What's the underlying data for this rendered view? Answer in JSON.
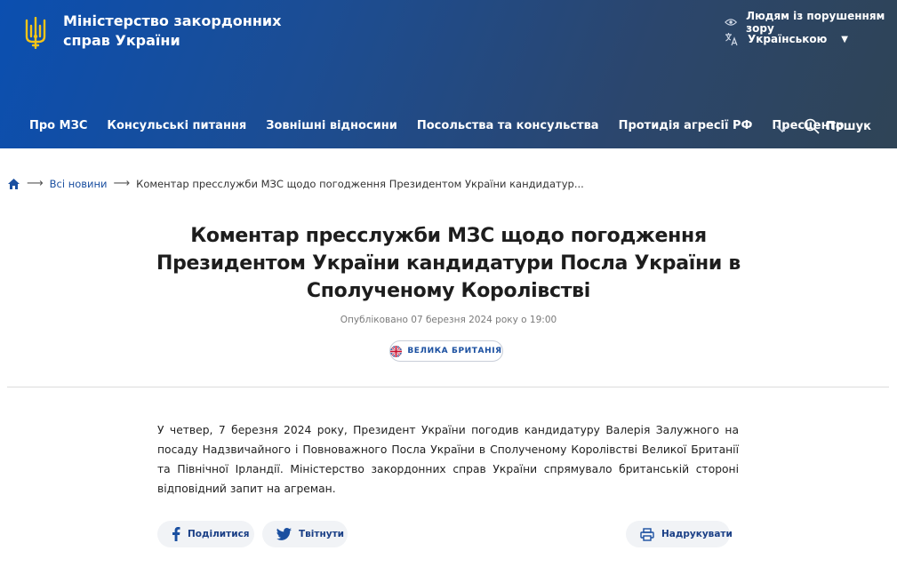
{
  "header": {
    "ministry_line1": "Міністерство закордонних",
    "ministry_line2": "справ України",
    "accessibility_label": "Людям із порушенням зору",
    "language_label": "Українською",
    "search_label": "Пошук",
    "nav": [
      "Про МЗС",
      "Консульські питання",
      "Зовнішні відносини",
      "Посольства та консульства",
      "Протидія агресії РФ",
      "Пресцентр"
    ],
    "icons": {
      "logo": "trident-icon",
      "accessibility": "glasses-icon",
      "language": "translate-icon",
      "more": "chevron-down-icon",
      "search": "search-icon"
    }
  },
  "breadcrumb": {
    "home_icon": "home-icon",
    "items": [
      "Всі новини",
      "Коментар пресслужби МЗС щодо погодження Президентом України кандидатур..."
    ]
  },
  "article": {
    "title": "Коментар пресслужби МЗС щодо погодження Президентом України кандидатури Посла України в Сполученому Королівстві",
    "published": "Опубліковано 07 березня 2024 року о 19:00",
    "tag": "ВЕЛИКА БРИТАНІЯ",
    "tag_icon": "uk-flag-icon",
    "body": "У четвер, 7 березня 2024 року, Президент України погодив кандидатуру Валерія Залужного на посаду Надзвичайного і Повноважного Посла України в Сполученому Королівстві Великої Британії та Північної Ірландії. Міністерство закордонних справ України спрямувало британській стороні відповідний запит на агреман."
  },
  "actions": {
    "share": "Поділитися",
    "tweet": "Твітнути",
    "print": "Надрукувати"
  },
  "colors": {
    "header_start": "#0b4fb0",
    "header_end": "#2f4456",
    "link": "#1a4fa0",
    "button_bg": "#f1f3f6"
  }
}
